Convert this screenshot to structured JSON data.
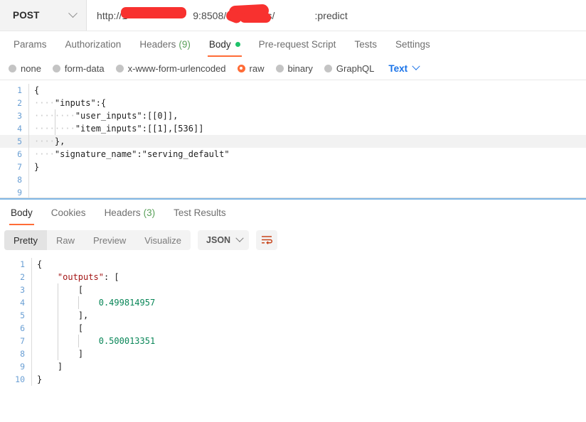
{
  "url_bar": {
    "method": "POST",
    "url_prefix": "http://1",
    "url_middle": "9:8508/v1/models/",
    "url_suffix": ":predict",
    "full_url_visible": "http://1████9:8508/v1/models/███:predict",
    "redaction_color": "#f8312f"
  },
  "request_tabs": {
    "items": [
      {
        "label": "Params",
        "active": false
      },
      {
        "label": "Authorization",
        "active": false
      },
      {
        "label": "Headers",
        "count": "(9)",
        "active": false
      },
      {
        "label": "Body",
        "active": true,
        "dot": true
      },
      {
        "label": "Pre-request Script",
        "active": false
      },
      {
        "label": "Tests",
        "active": false
      },
      {
        "label": "Settings",
        "active": false
      }
    ],
    "active_indicator_color": "#ff6c37",
    "dot_color": "#1ec26a"
  },
  "body_type": {
    "options": [
      {
        "label": "none",
        "selected": false
      },
      {
        "label": "form-data",
        "selected": false
      },
      {
        "label": "x-www-form-urlencoded",
        "selected": false
      },
      {
        "label": "raw",
        "selected": true
      },
      {
        "label": "binary",
        "selected": false
      },
      {
        "label": "GraphQL",
        "selected": false
      }
    ],
    "format_label": "Text",
    "format_color": "#1a73e8",
    "selected_color": "#ff6c37"
  },
  "request_body": {
    "lines": [
      {
        "n": "1",
        "indent": 0,
        "text": "{",
        "highlight": false
      },
      {
        "n": "2",
        "indent": 1,
        "text": "\"inputs\":{",
        "highlight": false
      },
      {
        "n": "3",
        "indent": 2,
        "text": "\"user_inputs\":[[0]],",
        "highlight": false
      },
      {
        "n": "4",
        "indent": 2,
        "text": "\"item_inputs\":[[1],[536]]",
        "highlight": false
      },
      {
        "n": "5",
        "indent": 1,
        "text": "},",
        "highlight": true
      },
      {
        "n": "6",
        "indent": 1,
        "text": "\"signature_name\":\"serving_default\"",
        "highlight": false
      },
      {
        "n": "7",
        "indent": 0,
        "text": "}",
        "highlight": false
      },
      {
        "n": "8",
        "indent": 0,
        "text": "",
        "highlight": false
      },
      {
        "n": "9",
        "indent": 0,
        "text": "",
        "highlight": false
      }
    ]
  },
  "response_tabs": {
    "items": [
      {
        "label": "Body",
        "active": true
      },
      {
        "label": "Cookies",
        "active": false
      },
      {
        "label": "Headers",
        "count": "(3)",
        "active": false
      },
      {
        "label": "Test Results",
        "active": false
      }
    ]
  },
  "response_toolbar": {
    "segments": [
      {
        "label": "Pretty",
        "active": true
      },
      {
        "label": "Raw",
        "active": false
      },
      {
        "label": "Preview",
        "active": false
      },
      {
        "label": "Visualize",
        "active": false
      }
    ],
    "format": "JSON",
    "wrap_icon_color": "#c8451b"
  },
  "response_body": {
    "lines": [
      {
        "n": "1",
        "indent": 0,
        "segs": [
          {
            "t": "{",
            "c": "pun"
          }
        ]
      },
      {
        "n": "2",
        "indent": 1,
        "segs": [
          {
            "t": "\"outputs\"",
            "c": "key"
          },
          {
            "t": ": [",
            "c": "pun"
          }
        ]
      },
      {
        "n": "3",
        "indent": 2,
        "segs": [
          {
            "t": "[",
            "c": "pun"
          }
        ]
      },
      {
        "n": "4",
        "indent": 3,
        "segs": [
          {
            "t": "0.499814957",
            "c": "num"
          }
        ]
      },
      {
        "n": "5",
        "indent": 2,
        "segs": [
          {
            "t": "],",
            "c": "pun"
          }
        ]
      },
      {
        "n": "6",
        "indent": 2,
        "segs": [
          {
            "t": "[",
            "c": "pun"
          }
        ]
      },
      {
        "n": "7",
        "indent": 3,
        "segs": [
          {
            "t": "0.500013351",
            "c": "num"
          }
        ]
      },
      {
        "n": "8",
        "indent": 2,
        "segs": [
          {
            "t": "]",
            "c": "pun"
          }
        ]
      },
      {
        "n": "9",
        "indent": 1,
        "segs": [
          {
            "t": "]",
            "c": "pun"
          }
        ]
      },
      {
        "n": "10",
        "indent": 0,
        "segs": [
          {
            "t": "}",
            "c": "pun"
          }
        ]
      }
    ],
    "values": [
      0.499814957,
      0.500013351
    ]
  }
}
